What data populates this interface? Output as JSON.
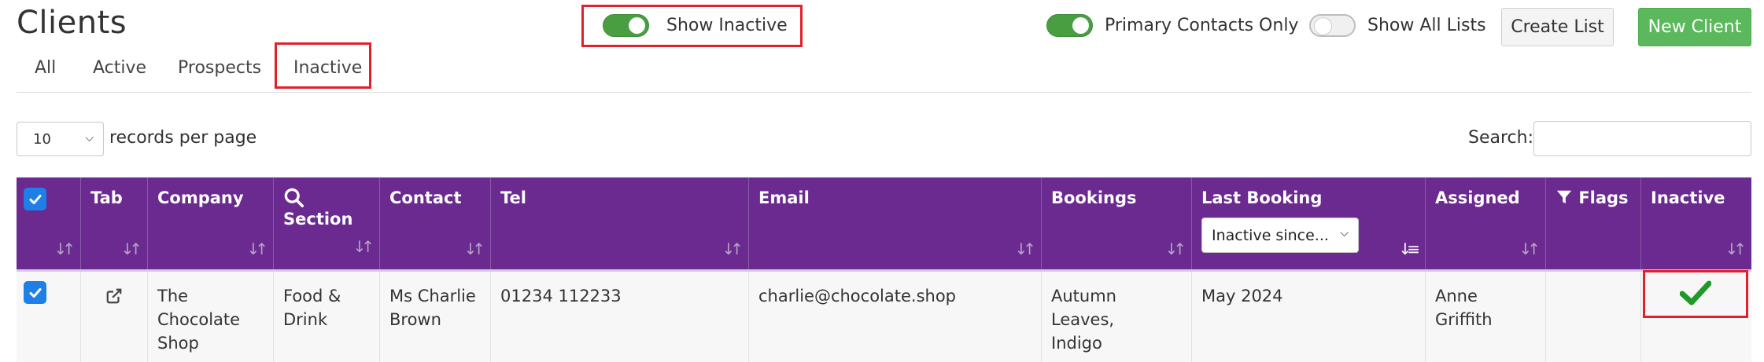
{
  "page": {
    "title": "Clients"
  },
  "toggles": {
    "show_inactive": {
      "label": "Show Inactive",
      "on": true
    },
    "primary_contacts": {
      "label": "Primary Contacts Only",
      "on": true
    },
    "show_all_lists": {
      "label": "Show All Lists",
      "on": false
    }
  },
  "buttons": {
    "create_list": "Create List",
    "new_client": "New Client"
  },
  "tabs": [
    {
      "label": "All",
      "active": false
    },
    {
      "label": "Active",
      "active": false
    },
    {
      "label": "Prospects",
      "active": false
    },
    {
      "label": "Inactive",
      "active": true
    }
  ],
  "table_controls": {
    "page_length": "10",
    "page_length_label": "records per page",
    "search_label": "Search:",
    "search_value": ""
  },
  "table": {
    "columns": {
      "tab": "Tab",
      "company": "Company",
      "section": "Section",
      "contact": "Contact",
      "tel": "Tel",
      "email": "Email",
      "bookings": "Bookings",
      "last_booking": "Last Booking",
      "assigned": "Assigned",
      "flags": "Flags",
      "inactive": "Inactive"
    },
    "last_booking_filter": "Inactive since...",
    "rows": [
      {
        "selected": true,
        "company": [
          "The",
          "Chocolate",
          "Shop"
        ],
        "section": [
          "Food &",
          "Drink"
        ],
        "contact": [
          "Ms Charlie",
          "Brown"
        ],
        "tel": "01234 112233",
        "email": "charlie@chocolate.shop",
        "bookings": [
          "Autumn Leaves,",
          "Indigo"
        ],
        "last_booking": "May 2024",
        "assigned": "Anne Griffith",
        "flags": "",
        "inactive": true
      }
    ]
  },
  "colors": {
    "header_purple": "#6a2a8f",
    "toggle_green": "#4a9e42",
    "button_green": "#5cb85c",
    "highlight_red": "#e0202a",
    "check_green": "#1f9a2a",
    "checkbox_blue": "#1e7fe8"
  }
}
